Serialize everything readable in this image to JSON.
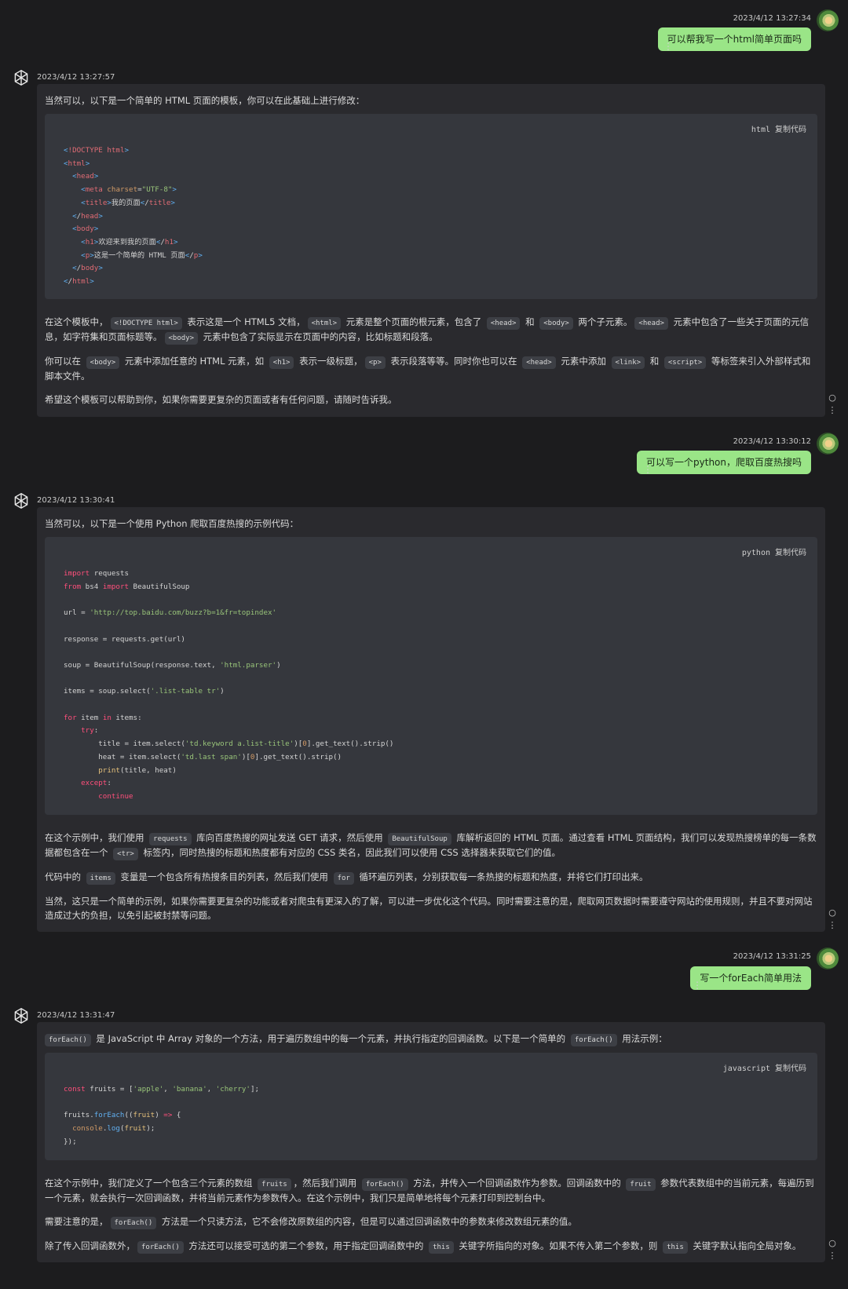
{
  "conversation": {
    "m1": {
      "timestamp": "2023/4/12 13:27:34",
      "text": "可以帮我写一个html简单页面吗"
    },
    "r1": {
      "timestamp": "2023/4/12 13:27:57",
      "intro": "当然可以，以下是一个简单的 HTML 页面的模板，你可以在此基础上进行修改：",
      "code_lang": "html",
      "copy_label": "复制代码",
      "p1": {
        "a": "在这个模板中，",
        "c1": "<!DOCTYPE html>",
        "b": " 表示这是一个 HTML5 文档，",
        "c2": "<html>",
        "c": " 元素是整个页面的根元素，包含了 ",
        "c3": "<head>",
        "d": " 和 ",
        "c4": "<body>",
        "e": " 两个子元素。",
        "c5": "<head>",
        "f": " 元素中包含了一些关于页面的元信息，如字符集和页面标题等。",
        "c6": "<body>",
        "g": " 元素中包含了实际显示在页面中的内容，比如标题和段落。"
      },
      "p2": {
        "a": "你可以在 ",
        "c1": "<body>",
        "b": " 元素中添加任意的 HTML 元素，如 ",
        "c2": "<h1>",
        "c": " 表示一级标题，",
        "c3": "<p>",
        "d": " 表示段落等等。同时你也可以在 ",
        "c4": "<head>",
        "e": " 元素中添加 ",
        "c5": "<link>",
        "f": " 和 ",
        "c6": "<script>",
        "g": " 等标签来引入外部样式和脚本文件。"
      },
      "p3": "希望这个模板可以帮助到你，如果你需要更复杂的页面或者有任何问题，请随时告诉我。"
    },
    "m2": {
      "timestamp": "2023/4/12 13:30:12",
      "text": "可以写一个python，爬取百度热搜吗"
    },
    "r2": {
      "timestamp": "2023/4/12 13:30:41",
      "intro": "当然可以，以下是一个使用 Python 爬取百度热搜的示例代码：",
      "code_lang": "python",
      "copy_label": "复制代码",
      "p1": {
        "a": "在这个示例中，我们使用 ",
        "c1": "requests",
        "b": " 库向百度热搜的网址发送 GET 请求，然后使用 ",
        "c2": "BeautifulSoup",
        "c": " 库解析返回的 HTML 页面。通过查看 HTML 页面结构，我们可以发现热搜榜单的每一条数据都包含在一个 ",
        "c3": "<tr>",
        "d": " 标签内，同时热搜的标题和热度都有对应的 CSS 类名，因此我们可以使用 CSS 选择器来获取它们的值。"
      },
      "p2": {
        "a": "代码中的 ",
        "c1": "items",
        "b": " 变量是一个包含所有热搜条目的列表，然后我们使用 ",
        "c2": "for",
        "c": " 循环遍历列表，分别获取每一条热搜的标题和热度，并将它们打印出来。"
      },
      "p3": "当然，这只是一个简单的示例，如果你需要更复杂的功能或者对爬虫有更深入的了解，可以进一步优化这个代码。同时需要注意的是，爬取网页数据时需要遵守网站的使用规则，并且不要对网站造成过大的负担，以免引起被封禁等问题。"
    },
    "m3": {
      "timestamp": "2023/4/12 13:31:25",
      "text": "写一个forEach简单用法"
    },
    "r3": {
      "timestamp": "2023/4/12 13:31:47",
      "intro": {
        "c1": "forEach()",
        "a": " 是 JavaScript 中 Array 对象的一个方法，用于遍历数组中的每一个元素，并执行指定的回调函数。以下是一个简单的 ",
        "c2": "forEach()",
        "b": " 用法示例："
      },
      "code_lang": "javascript",
      "copy_label": "复制代码",
      "p1": {
        "a": "在这个示例中，我们定义了一个包含三个元素的数组 ",
        "c1": "fruits",
        "b": "，然后我们调用 ",
        "c2": "forEach()",
        "c": " 方法，并传入一个回调函数作为参数。回调函数中的 ",
        "c3": "fruit",
        "d": " 参数代表数组中的当前元素，每遍历到一个元素，就会执行一次回调函数，并将当前元素作为参数传入。在这个示例中，我们只是简单地将每个元素打印到控制台中。"
      },
      "p2": {
        "a": "需要注意的是，",
        "c1": "forEach()",
        "b": " 方法是一个只读方法，它不会修改原数组的内容，但是可以通过回调函数中的参数来修改数组元素的值。"
      },
      "p3": {
        "a": "除了传入回调函数外，",
        "c1": "forEach()",
        "b": " 方法还可以接受可选的第二个参数，用于指定回调函数中的 ",
        "c2": "this",
        "c": " 关键字所指向的对象。如果不传入第二个参数，则 ",
        "c3": "this",
        "d": " 关键字默认指向全局对象。"
      }
    }
  },
  "code_html": [
    "<!DOCTYPE html>",
    "<html>",
    "  <head>",
    "    <meta charset=\"UTF-8\">",
    "    <title>我的页面</title>",
    "  </head>",
    "  <body>",
    "    <h1>欢迎来到我的页面</h1>",
    "    <p>这是一个简单的 HTML 页面</p>",
    "  </body>",
    "</html>"
  ],
  "code_python": [
    "import requests",
    "from bs4 import BeautifulSoup",
    "",
    "url = 'http://top.baidu.com/buzz?b=1&fr=topindex'",
    "",
    "response = requests.get(url)",
    "",
    "soup = BeautifulSoup(response.text, 'html.parser')",
    "",
    "items = soup.select('.list-table tr')",
    "",
    "for item in items:",
    "    try:",
    "        title = item.select('td.keyword a.list-title')[0].get_text().strip()",
    "        heat = item.select('td.last span')[0].get_text().strip()",
    "        print(title, heat)",
    "    except:",
    "        continue"
  ],
  "code_js": [
    "const fruits = ['apple', 'banana', 'cherry'];",
    "",
    "fruits.forEach((fruit) => {",
    "  console.log(fruit);",
    "});"
  ],
  "icons": {
    "more": "⋮",
    "regenerate": "○"
  }
}
